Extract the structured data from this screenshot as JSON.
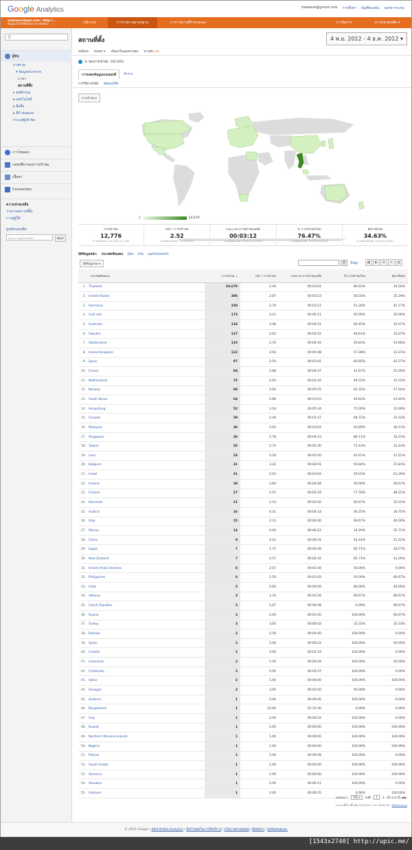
{
  "header": {
    "logo": "Google",
    "logo_suffix": "Analytics",
    "email": "toewave@gmail.com",
    "settings": "การตั้งค่า",
    "account": "บัญชีของฉัน",
    "signout": "ออกจากระบบ"
  },
  "nav": {
    "account_line1": "ssspreevshopn.com - http://...",
    "account_line2": "ข้อมูลเว็บไซต์ทั้งหมด [ค่าเริ่มต้น]",
    "tabs": [
      "หน้าแรก",
      "การรายงานมาตรฐาน",
      "การรายงานที่กำหนดเอง"
    ],
    "right_tabs": [
      "การจัดการ",
      "ความช่วยเหลือ ▾"
    ]
  },
  "left": {
    "audience": "ผู้ชม",
    "items": [
      "ภาพรวม",
      "▾ ข้อมูลประชากร",
      "ภาษา",
      "สถานที่ตั้ง",
      "▸ พฤติกรรม",
      "▸ เทคโนโลยี",
      "▸ มือถือ",
      "▸ ที่กำหนดเอง",
      "กระแสผู้เข้าชม"
    ],
    "sections": [
      "การโฆษณา",
      "แหล่งที่มาของการเข้าชม",
      "เนื้อหา",
      "Conversion"
    ],
    "help_title": "ความช่วยเหลือ",
    "help_links": [
      "รายงานสถานที่ตั้ง",
      "การดูผู้ใช้"
    ],
    "help_center": "ศูนย์ช่วยเหลือ",
    "help_search_placeholder": "ค้นหาจากศูนย์ช่วยเหลือ",
    "help_go": "ค้นหา"
  },
  "page": {
    "title": "สถานที่ตั้ง",
    "date": "4 พ.ย. 2012 - 4 ธ.ค. 2012",
    "actions": [
      "ส่งอีเมล",
      "ส่งออก ▾",
      "เพิ่มลงในแผงควบคุม",
      "ทางลัด"
    ],
    "action_new": "เบต้า",
    "segment": "% ของการเข้าชม: 100.00%",
    "tab_on": "การแสดงข้อมูลแบบแผนที่",
    "tab_link": "สำรวจ",
    "subtab_on": "การใช้งานไซต์",
    "subtab_link": "อีคอมเมิร์ซ",
    "metric_select": "การเข้าชม ▾",
    "legend_min": "1",
    "legend_max": "10,679"
  },
  "summary": [
    {
      "label": "การเข้าชม",
      "value": "12,776",
      "sub": "% ของทั้งหมด: 100.00% (12,776)"
    },
    {
      "label": "หน้า / การเข้าชม",
      "value": "2.52",
      "sub": "ค่าเฉลี่ยของไซต์: 2.52 (0.00%)"
    },
    {
      "label": "ระยะเวลาการเข้าชมเฉลี่ย",
      "value": "00:03:12",
      "sub": "ค่าเฉลี่ยของไซต์: 00:03:12 (0.00%)"
    },
    {
      "label": "% การเข้าชมใหม่",
      "value": "76.47%",
      "sub": "ค่าเฉลี่ยของไซต์: 76.47% (0.00%)"
    },
    {
      "label": "อัตราตีกลับ",
      "value": "34.63%",
      "sub": "ค่าเฉลี่ยของไซต์: 34.63% (0.00%)"
    }
  ],
  "dims": {
    "label": "มิติข้อมูลหลัก:",
    "current": "ประเทศ/ดินแดน",
    "others": [
      "เมือง",
      "ทวีป",
      "อนุทวีปของทวีป"
    ]
  },
  "table_tools": {
    "secondary": "มิติข้อมูลรอง ▾",
    "advanced": "ขั้นสูง"
  },
  "columns": [
    "ประเทศ/ดินแดน",
    "การเข้าชม",
    "↓",
    "หน้า / การเข้าชม",
    "ระยะเวลาการเข้าชมเฉลี่ย",
    "% การเข้าชมใหม่",
    "อัตราตีกลับ"
  ],
  "rows": [
    [
      "1.",
      "Thailand",
      "10,679",
      "2.44",
      "00:03:01",
      "80.93%",
      "34.50%"
    ],
    [
      "2.",
      "United States",
      "306",
      "2.87",
      "00:03:53",
      "58.50%",
      "35.29%"
    ],
    [
      "3.",
      "Germany",
      "230",
      "2.70",
      "00:03:12",
      "51.30%",
      "42.17%"
    ],
    [
      "4.",
      "(not set)",
      "173",
      "3.21",
      "00:05:11",
      "65.90%",
      "30.06%"
    ],
    [
      "5.",
      "Australia",
      "134",
      "3.46",
      "00:06:51",
      "60.45%",
      "35.07%"
    ],
    [
      "6.",
      "Sweden",
      "127",
      "2.62",
      "00:02:52",
      "49.61%",
      "33.07%"
    ],
    [
      "7.",
      "Switzerland",
      "123",
      "2.70",
      "00:04:34",
      "26.83%",
      "53.66%"
    ],
    [
      "8.",
      "United Kingdom",
      "122",
      "2.93",
      "00:05:48",
      "57.38%",
      "31.15%"
    ],
    [
      "9.",
      "Japan",
      "97",
      "2.54",
      "00:03:41",
      "60.82%",
      "42.27%"
    ],
    [
      "10.",
      "France",
      "84",
      "2.68",
      "00:04:37",
      "41.67%",
      "25.00%"
    ],
    [
      "11.",
      "Netherlands",
      "75",
      "2.93",
      "00:02:44",
      "49.33%",
      "33.33%"
    ],
    [
      "12.",
      "Norway",
      "69",
      "4.64",
      "00:05:55",
      "62.32%",
      "27.54%"
    ],
    [
      "13.",
      "South Korea",
      "64",
      "2.86",
      "00:03:03",
      "40.62%",
      "23.44%"
    ],
    [
      "14.",
      "Hong Kong",
      "52",
      "3.19",
      "00:05:24",
      "75.00%",
      "32.69%"
    ],
    [
      "15.",
      "Canada",
      "39",
      "2.44",
      "00:01:27",
      "48.72%",
      "33.33%"
    ],
    [
      "16.",
      "Malaysia",
      "36",
      "4.03",
      "00:03:03",
      "63.89%",
      "36.11%"
    ],
    [
      "17.",
      "Singapore",
      "36",
      "2.78",
      "00:04:23",
      "86.11%",
      "33.33%"
    ],
    [
      "18.",
      "Taiwan",
      "35",
      "2.74",
      "00:02:30",
      "71.43%",
      "31.43%"
    ],
    [
      "19.",
      "Laos",
      "33",
      "3.18",
      "00:05:45",
      "42.42%",
      "21.21%"
    ],
    [
      "20.",
      "Belgium",
      "31",
      "3.32",
      "00:04:01",
      "54.84%",
      "25.81%"
    ],
    [
      "21.",
      "Israel",
      "31",
      "2.03",
      "00:03:04",
      "29.03%",
      "61.29%"
    ],
    [
      "22.",
      "Ireland",
      "30",
      "3.60",
      "00:04:08",
      "30.00%",
      "26.67%"
    ],
    [
      "23.",
      "Finland",
      "27",
      "2.15",
      "00:02:18",
      "77.78%",
      "48.15%"
    ],
    [
      "24.",
      "Denmark",
      "21",
      "2.14",
      "00:02:02",
      "66.67%",
      "33.33%"
    ],
    [
      "25.",
      "Austria",
      "16",
      "4.31",
      "00:04:14",
      "56.25%",
      "18.75%"
    ],
    [
      "26.",
      "Italy",
      "15",
      "2.13",
      "00:04:00",
      "66.67%",
      "40.00%"
    ],
    [
      "27.",
      "Macau",
      "14",
      "4.00",
      "00:06:12",
      "14.29%",
      "35.71%"
    ],
    [
      "28.",
      "China",
      "9",
      "4.22",
      "00:06:31",
      "44.44%",
      "22.22%"
    ],
    [
      "29.",
      "Egypt",
      "7",
      "1.71",
      "00:00:49",
      "85.71%",
      "28.57%"
    ],
    [
      "30.",
      "New Zealand",
      "7",
      "2.57",
      "00:02:32",
      "85.71%",
      "14.29%"
    ],
    [
      "31.",
      "United Arab Emirates",
      "6",
      "2.67",
      "00:01:56",
      "50.00%",
      "0.00%"
    ],
    [
      "32.",
      "Philippines",
      "6",
      "1.50",
      "00:01:02",
      "50.00%",
      "66.67%"
    ],
    [
      "33.",
      "India",
      "5",
      "2.60",
      "00:09:56",
      "80.00%",
      "40.00%"
    ],
    [
      "34.",
      "Albania",
      "3",
      "1.33",
      "00:03:26",
      "66.67%",
      "66.67%"
    ],
    [
      "35.",
      "Czech Republic",
      "3",
      "1.67",
      "00:00:48",
      "0.00%",
      "66.67%"
    ],
    [
      "36.",
      "Russia",
      "3",
      "2.00",
      "00:01:00",
      "100.00%",
      "66.67%"
    ],
    [
      "37.",
      "Turkey",
      "3",
      "3.00",
      "00:00:42",
      "33.33%",
      "33.33%"
    ],
    [
      "38.",
      "Bahrain",
      "2",
      "2.50",
      "00:04:00",
      "100.00%",
      "0.00%"
    ],
    [
      "39.",
      "Spain",
      "2",
      "2.00",
      "00:00:22",
      "100.00%",
      "50.00%"
    ],
    [
      "40.",
      "Croatia",
      "2",
      "3.00",
      "00:01:19",
      "100.00%",
      "0.00%"
    ],
    [
      "41.",
      "Indonesia",
      "2",
      "1.50",
      "00:00:29",
      "100.00%",
      "50.00%"
    ],
    [
      "42.",
      "Cambodia",
      "2",
      "5.00",
      "00:02:57",
      "100.00%",
      "0.00%"
    ],
    [
      "43.",
      "Qatar",
      "2",
      "1.00",
      "00:00:00",
      "100.00%",
      "100.00%"
    ],
    [
      "44.",
      "Senegal",
      "2",
      "3.00",
      "00:03:50",
      "50.00%",
      "0.00%"
    ],
    [
      "45.",
      "Andorra",
      "1",
      "2.00",
      "00:00:45",
      "100.00%",
      "0.00%"
    ],
    [
      "46.",
      "Bangladesh",
      "1",
      "23.00",
      "01:31:30",
      "0.00%",
      "0.00%"
    ],
    [
      "47.",
      "Iraq",
      "1",
      "2.00",
      "00:00:16",
      "100.00%",
      "0.00%"
    ],
    [
      "48.",
      "Kuwait",
      "1",
      "1.00",
      "00:00:00",
      "100.00%",
      "100.00%"
    ],
    [
      "49.",
      "Northern Mariana Islands",
      "1",
      "1.00",
      "00:00:00",
      "100.00%",
      "100.00%"
    ],
    [
      "50.",
      "Nigeria",
      "1",
      "1.00",
      "00:00:00",
      "100.00%",
      "100.00%"
    ],
    [
      "51.",
      "Poland",
      "1",
      "2.00",
      "00:00:28",
      "100.00%",
      "0.00%"
    ],
    [
      "52.",
      "Saudi Arabia",
      "1",
      "1.00",
      "00:00:00",
      "100.00%",
      "100.00%"
    ],
    [
      "53.",
      "Slovenia",
      "1",
      "1.00",
      "00:00:00",
      "100.00%",
      "100.00%"
    ],
    [
      "54.",
      "Slovakia",
      "1",
      "2.00",
      "00:00:11",
      "100.00%",
      "0.00%"
    ],
    [
      "55.",
      "Vietnam",
      "1",
      "2.00",
      "00:00:35",
      "0.00%",
      "100.00%"
    ]
  ],
  "pagination": {
    "show_label": "แสดงแถว:",
    "show_value": "500 ▾",
    "goto_label": "ไปที่:",
    "goto_value": "1",
    "range": "1 - 55 จาก 55 ◀ ▶"
  },
  "report_note": "รายงานนี้สร้างขึ้นเมื่อ 5/12/2012 เวลา 18:52:06 -",
  "report_refresh": "รีเฟรชรายงาน",
  "footer": {
    "copyright": "© 2012 Google",
    "links": [
      "หน้าแรกของ Analytics",
      "ข้อกำหนดในการให้บริการ",
      "นโยบายส่วนบุคคล",
      "ติดต่อเรา",
      "ส่งข้อเสนอแนะ"
    ]
  },
  "watermark": "[1543x2740] http://upic.me/",
  "colors": {
    "accent": "#e46d20",
    "link": "#2b5ba8",
    "map_land": "#dcdcdc",
    "map_low": "#d4f0c0",
    "map_high": "#3a8a1f"
  }
}
